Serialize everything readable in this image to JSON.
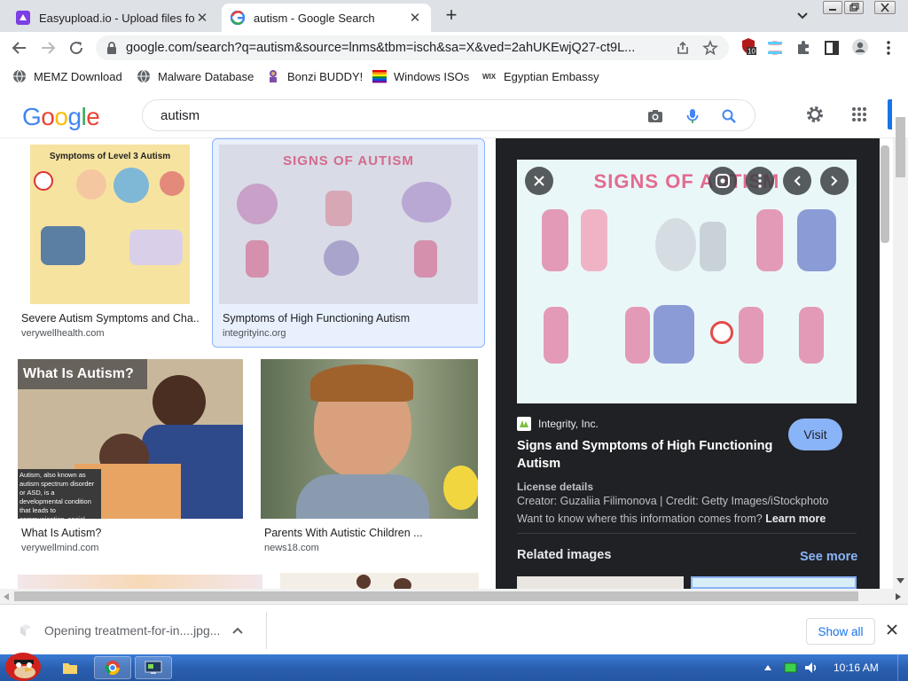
{
  "tabs": [
    {
      "title": "Easyupload.io - Upload files fo",
      "close": "✕"
    },
    {
      "title": "autism - Google Search",
      "close": "✕"
    }
  ],
  "new_tab": "+",
  "address": {
    "url": "google.com/search?q=autism&source=lnms&tbm=isch&sa=X&ved=2ahUKEwjQ27-ct9L..."
  },
  "extension_badge": "10",
  "bookmarks": [
    {
      "label": "MEMZ Download",
      "icon": "globe-icon"
    },
    {
      "label": "Malware Database",
      "icon": "globe-icon"
    },
    {
      "label": "Bonzi BUDDY!",
      "icon": "bonzi-icon"
    },
    {
      "label": "Windows ISOs",
      "icon": "windows-flag-icon"
    },
    {
      "label": "Egyptian Embassy",
      "icon": "wix-icon"
    }
  ],
  "google": {
    "logo": "Google",
    "query": "autism"
  },
  "results": [
    {
      "caption": "Severe Autism Symptoms and Cha...",
      "site": "verywellhealth.com",
      "thumb_text": "Symptoms of Level 3 Autism"
    },
    {
      "caption": "Symptoms of High Functioning Autism",
      "site": "integrityinc.org",
      "thumb_text": "SIGNS OF AUTISM"
    },
    {
      "caption": "What Is Autism?",
      "site": "verywellmind.com",
      "thumb_text": "What Is Autism?",
      "thumb_body": "Autism, also known as autism spectrum disorder or ASD, is a developmental condition that leads to communication, social, and behavioral challenges."
    },
    {
      "caption": "Parents With Autistic Children ...",
      "site": "news18.com"
    }
  ],
  "panel": {
    "preview_title": "SIGNS OF AUTISM",
    "source": "Integrity, Inc.",
    "title": "Signs and Symptoms of High Functioning Autism",
    "visit": "Visit",
    "license_heading": "License details",
    "credit": "Creator: Guzaliia Filimonova | Credit: Getty Images/iStockphoto",
    "question": "Want to know where this information comes from?",
    "learn_more": "Learn more",
    "related": "Related images",
    "see_more": "See more"
  },
  "download": {
    "filename": "Opening treatment-for-in....jpg...",
    "show_all": "Show all"
  },
  "taskbar": {
    "time": "10:16 AM"
  },
  "colors": {
    "google_blue": "#4285f4",
    "google_red": "#ea4335",
    "google_yellow": "#fbbc05",
    "google_green": "#34a853",
    "panel_bg": "#202124",
    "link_blue": "#8ab4f8"
  }
}
